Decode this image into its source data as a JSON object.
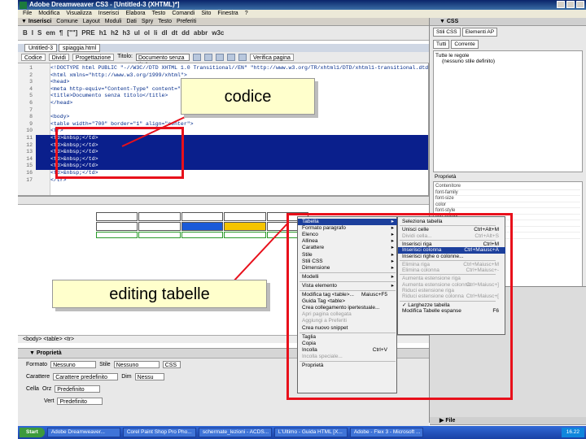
{
  "window": {
    "title": "Adobe Dreamweaver CS3 - [Untitled-3 (XHTML)*]"
  },
  "menu": [
    "File",
    "Modifica",
    "Visualizza",
    "Inserisci",
    "Elabora",
    "Testo",
    "Comandi",
    "Sito",
    "Finestra",
    "?"
  ],
  "insert_bar": {
    "title": "▼ Inserisci",
    "tabs": [
      "Comune",
      "Layout",
      "Moduli",
      "Dati",
      "Spry",
      "Testo",
      "Preferiti"
    ]
  },
  "format_bar": [
    "B",
    "I",
    "S",
    "em",
    "¶",
    "[\"\"]",
    "PRE",
    "h1",
    "h2",
    "h3",
    "ul",
    "ol",
    "li",
    "dl",
    "dt",
    "dd",
    "abbr",
    "w3c"
  ],
  "doc_tabs": [
    "Untitled-3",
    "spiaggia.html"
  ],
  "view_bar": {
    "code": "Codice",
    "split": "Dividi",
    "design": "Progettazione",
    "title_label": "Titolo:",
    "title_value": "Documento senza titolo",
    "check": "Verifica pagina"
  },
  "code_lines": [
    {
      "n": "1",
      "t": "<!DOCTYPE html PUBLIC \"-//W3C//DTD XHTML 1.0 Transitional//EN\" \"http://www.w3.org/TR/xhtml1/DTD/xhtml1-transitional.dtd\">",
      "sel": false
    },
    {
      "n": "2",
      "t": "<html xmlns=\"http://www.w3.org/1999/xhtml\">",
      "sel": false
    },
    {
      "n": "3",
      "t": "<head>",
      "sel": false
    },
    {
      "n": "4",
      "t": "<meta http-equiv=\"Content-Type\" content=\"t",
      "sel": false
    },
    {
      "n": "5",
      "t": "<title>Documento senza titolo</title>",
      "sel": false
    },
    {
      "n": "6",
      "t": "</head>",
      "sel": false
    },
    {
      "n": "7",
      "t": "",
      "sel": false
    },
    {
      "n": "8",
      "t": "<body>",
      "sel": false
    },
    {
      "n": "9",
      "t": "<table width=\"700\" border=\"1\" align=\"center\">",
      "sel": false
    },
    {
      "n": "10",
      "t": "  <tr>",
      "sel": false
    },
    {
      "n": "11",
      "t": "    <td>&nbsp;</td>",
      "sel": true
    },
    {
      "n": "12",
      "t": "    <td>&nbsp;</td>",
      "sel": true
    },
    {
      "n": "13",
      "t": "    <td>&nbsp;</td>",
      "sel": true
    },
    {
      "n": "14",
      "t": "    <td>&nbsp;</td>",
      "sel": true
    },
    {
      "n": "15",
      "t": "    <td>&nbsp;</td>",
      "sel": true
    },
    {
      "n": "16",
      "t": "    <td>&nbsp;</td>",
      "sel": false
    },
    {
      "n": "17",
      "t": "  </tr>",
      "sel": false
    }
  ],
  "status_bar": "<body> <table> <tr>",
  "properties": {
    "title": "▼ Proprietà",
    "format_label": "Formato",
    "format_value": "Nessuno",
    "style_label": "Stile",
    "style_value": "Nessuno",
    "css": "CSS",
    "font_label": "Carattere",
    "font_value": "Carattere predefinito",
    "size_label": "Dim",
    "size_value": "Nessu",
    "cell_label": "Cella",
    "horz_label": "Orz",
    "horz_value": "Predefinito",
    "vert_label": "Vert",
    "vert_value": "Predefinito"
  },
  "css_panel": {
    "title": "▼ CSS",
    "tabs": [
      "Stili CSS",
      "Elementi AP"
    ],
    "mode": [
      "Tutti",
      "Corrente"
    ],
    "all_rules": "Tutte le regole",
    "no_style": "(nessuno stile definito)",
    "props_title": "Proprietà",
    "props": [
      "Contenitore",
      "font-family",
      "font-size",
      "color",
      "font-style",
      "line-height",
      "font-weight",
      "font-variant",
      "text-transform"
    ]
  },
  "files_panel": {
    "title": "▶ File"
  },
  "taskbar": {
    "start": "Start",
    "tasks": [
      "Adobe Dreamweaver...",
      "Corel Paint Shop Pro Pho...",
      "schermate_lezioni - ACDS...",
      "L'Ultimo - Guida HTML [X...",
      "Adobe - Flex 3 - Microsoft ..."
    ],
    "clock": "16.22"
  },
  "callouts": {
    "code": "codice",
    "table": "editing  tabelle"
  },
  "context_menu": [
    {
      "label": "Tabella",
      "arrow": true,
      "hi": true
    },
    {
      "label": "Formato paragrafo",
      "arrow": true
    },
    {
      "label": "Elenco",
      "arrow": true
    },
    {
      "label": "Allinea",
      "arrow": true
    },
    {
      "label": "Carattere",
      "arrow": true
    },
    {
      "label": "Stile",
      "arrow": true
    },
    {
      "label": "Stili CSS",
      "arrow": true
    },
    {
      "label": "Dimensione",
      "arrow": true
    },
    {
      "sep": true
    },
    {
      "label": "Modelli",
      "arrow": true
    },
    {
      "sep": true
    },
    {
      "label": "Vista elemento",
      "arrow": true
    },
    {
      "sep": true
    },
    {
      "label": "Modifica tag <table>...",
      "short": "Maiusc+F5"
    },
    {
      "label": "Guida Tag <table>"
    },
    {
      "label": "Crea collegamento ipertestuale..."
    },
    {
      "label": "Apri pagina collegata",
      "dis": true
    },
    {
      "label": "Aggiungi a Preferiti",
      "dis": true
    },
    {
      "label": "Crea nuovo snippet"
    },
    {
      "sep": true
    },
    {
      "label": "Taglia"
    },
    {
      "label": "Copia"
    },
    {
      "label": "Incolla",
      "short": "Ctrl+V"
    },
    {
      "label": "Incolla speciale...",
      "dis": true
    },
    {
      "sep": true
    },
    {
      "label": "Proprietà"
    }
  ],
  "sub_menu": [
    {
      "label": "Seleziona tabella"
    },
    {
      "sep": true
    },
    {
      "label": "Unisci celle",
      "short": "Ctrl+Alt+M"
    },
    {
      "label": "Dividi cella...",
      "short": "Ctrl+Alt+S",
      "dis": true
    },
    {
      "sep": true
    },
    {
      "label": "Inserisci riga",
      "short": "Ctrl+M"
    },
    {
      "label": "Inserisci colonna",
      "short": "Ctrl+Maiusc+A",
      "hi": true
    },
    {
      "label": "Inserisci righe o colonne..."
    },
    {
      "sep": true
    },
    {
      "label": "Elimina riga",
      "short": "Ctrl+Maiusc+M",
      "dis": true
    },
    {
      "label": "Elimina colonna",
      "short": "Ctrl+Maiusc+-",
      "dis": true
    },
    {
      "sep": true
    },
    {
      "label": "Aumenta estensione riga",
      "dis": true
    },
    {
      "label": "Aumenta estensione colonna",
      "short": "Ctrl+Maiusc+]",
      "dis": true
    },
    {
      "label": "Riduci estensione riga",
      "dis": true
    },
    {
      "label": "Riduci estensione colonna",
      "short": "Ctrl+Maiusc+[",
      "dis": true
    },
    {
      "sep": true
    },
    {
      "label": "✓ Larghezze tabella"
    },
    {
      "label": "Modifica Tabelle espanse",
      "short": "F6"
    }
  ],
  "colors": {
    "highlight": "#1c3f9c",
    "annotation": "#e8101b",
    "callout_bg": "#ffffcc",
    "selected_code": "#0a1f8c"
  }
}
